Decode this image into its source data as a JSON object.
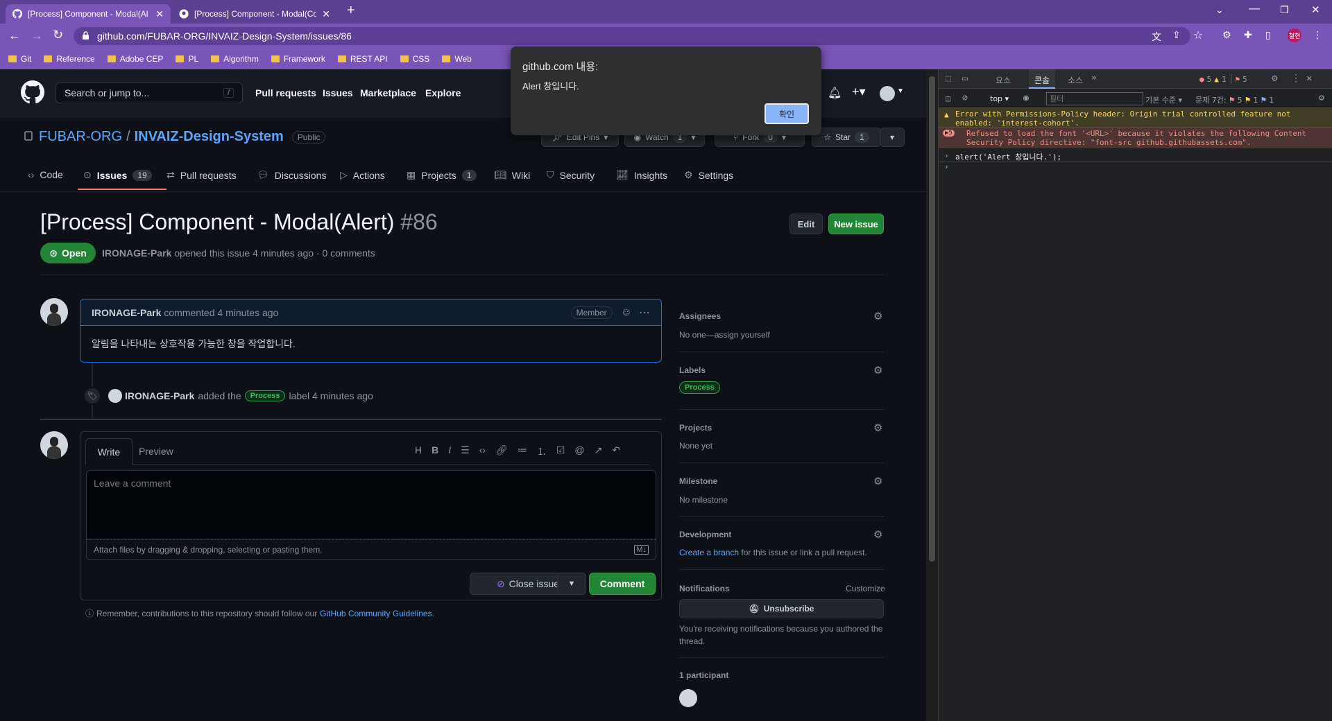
{
  "browser": {
    "tabs": [
      {
        "title": "[Process] Component - Modal(Al"
      },
      {
        "title": "[Process] Component - Modal(Co"
      }
    ],
    "url": "github.com/FUBAR-ORG/INVAIZ-Design-System/issues/86",
    "bookmarks": [
      "Git",
      "Reference",
      "Adobe CEP",
      "PL",
      "Algorithm",
      "Framework",
      "REST API",
      "CSS",
      "Web"
    ],
    "profile_initials": "철현"
  },
  "alert": {
    "title": "github.com 내용:",
    "message": "Alert 창입니다.",
    "ok_label": "확인"
  },
  "gh": {
    "search_placeholder": "Search or jump to...",
    "search_kbd": "/",
    "nav": [
      "Pull requests",
      "Issues",
      "Marketplace",
      "Explore"
    ],
    "org": "FUBAR-ORG",
    "sep": "/",
    "repo": "INVAIZ-Design-System",
    "visibility": "Public",
    "edit_pins": "Edit Pins",
    "watch": "Watch",
    "watch_count": "1",
    "fork": "Fork",
    "fork_count": "0",
    "star": "Star",
    "star_count": "1",
    "tabs": {
      "code": "Code",
      "issues": "Issues",
      "issues_count": "19",
      "pulls": "Pull requests",
      "discussions": "Discussions",
      "actions": "Actions",
      "projects": "Projects",
      "projects_count": "1",
      "wiki": "Wiki",
      "security": "Security",
      "insights": "Insights",
      "settings": "Settings"
    }
  },
  "issue": {
    "title": "[Process] Component - Modal(Alert)",
    "number": "#86",
    "edit_label": "Edit",
    "new_issue_label": "New issue",
    "state": "Open",
    "author": "IRONAGE-Park",
    "meta": "opened this issue 4 minutes ago · 0 comments",
    "comment": {
      "author": "IRONAGE-Park",
      "time": "commented 4 minutes ago",
      "role": "Member",
      "body": "알림을 나타내는 상호작용 가능한 창을 작업합니다."
    },
    "event": {
      "actor": "IRONAGE-Park",
      "text_before": "added the",
      "label": "Process",
      "text_after": "label 4 minutes ago"
    },
    "editor": {
      "write_tab": "Write",
      "preview_tab": "Preview",
      "placeholder": "Leave a comment",
      "attach_text": "Attach files by dragging & dropping, selecting or pasting them.",
      "close_issue": "Close issue",
      "comment_btn": "Comment"
    },
    "guidelines_text": "Remember, contributions to this repository should follow our",
    "guidelines_link": "GitHub Community Guidelines",
    "guidelines_end": "."
  },
  "sidebar": {
    "assignees_h": "Assignees",
    "assignees_v": "No one—assign yourself",
    "labels_h": "Labels",
    "labels_v": "Process",
    "projects_h": "Projects",
    "projects_v": "None yet",
    "milestone_h": "Milestone",
    "milestone_v": "No milestone",
    "development_h": "Development",
    "development_link": "Create a branch",
    "development_v": "for this issue or link a pull request.",
    "notifications_h": "Notifications",
    "customize": "Customize",
    "unsubscribe": "Unsubscribe",
    "notif_reason": "You're receiving notifications because you authored the thread.",
    "participants_h": "1 participant"
  },
  "devtools": {
    "tabs": [
      "요소",
      "콘솔",
      "소스"
    ],
    "more": "»",
    "errors": "5",
    "warnings": "1",
    "issues_badge": "5",
    "context": "top",
    "filter_placeholder": "필터",
    "levels": "기본 수준",
    "issues_label": "문제 7건:",
    "issues_err": "5",
    "issues_warn": "1",
    "issues_info": "1",
    "warning_msg": "Error with Permissions-Policy header: Origin trial controlled feature not enabled: 'interest-cohort'.",
    "error_count": "5",
    "error_msg": "Refused to load the font '<URL>' because it violates the following Content Security Policy directive: \"font-src github.githubassets.com\".",
    "command": "alert('Alert 창입니다.');"
  },
  "colors": {
    "accent_green": "#238636",
    "link_blue": "#58a6ff",
    "label_green": "#2ea043",
    "tab_purple": "#5b3f91"
  }
}
